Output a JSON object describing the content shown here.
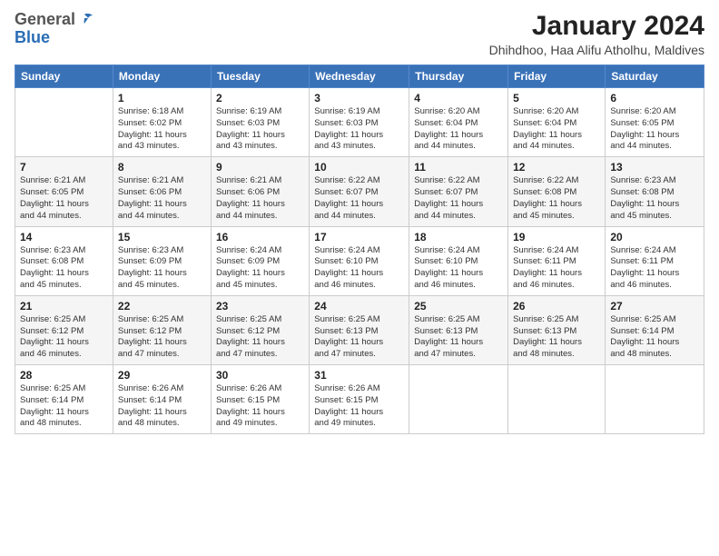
{
  "header": {
    "logo_line1": "General",
    "logo_line2": "Blue",
    "main_title": "January 2024",
    "subtitle": "Dhihdhoo, Haa Alifu Atholhu, Maldives"
  },
  "weekdays": [
    "Sunday",
    "Monday",
    "Tuesday",
    "Wednesday",
    "Thursday",
    "Friday",
    "Saturday"
  ],
  "weeks": [
    [
      {
        "date": "",
        "info": ""
      },
      {
        "date": "1",
        "info": "Sunrise: 6:18 AM\nSunset: 6:02 PM\nDaylight: 11 hours\nand 43 minutes."
      },
      {
        "date": "2",
        "info": "Sunrise: 6:19 AM\nSunset: 6:03 PM\nDaylight: 11 hours\nand 43 minutes."
      },
      {
        "date": "3",
        "info": "Sunrise: 6:19 AM\nSunset: 6:03 PM\nDaylight: 11 hours\nand 43 minutes."
      },
      {
        "date": "4",
        "info": "Sunrise: 6:20 AM\nSunset: 6:04 PM\nDaylight: 11 hours\nand 44 minutes."
      },
      {
        "date": "5",
        "info": "Sunrise: 6:20 AM\nSunset: 6:04 PM\nDaylight: 11 hours\nand 44 minutes."
      },
      {
        "date": "6",
        "info": "Sunrise: 6:20 AM\nSunset: 6:05 PM\nDaylight: 11 hours\nand 44 minutes."
      }
    ],
    [
      {
        "date": "7",
        "info": "Sunrise: 6:21 AM\nSunset: 6:05 PM\nDaylight: 11 hours\nand 44 minutes."
      },
      {
        "date": "8",
        "info": "Sunrise: 6:21 AM\nSunset: 6:06 PM\nDaylight: 11 hours\nand 44 minutes."
      },
      {
        "date": "9",
        "info": "Sunrise: 6:21 AM\nSunset: 6:06 PM\nDaylight: 11 hours\nand 44 minutes."
      },
      {
        "date": "10",
        "info": "Sunrise: 6:22 AM\nSunset: 6:07 PM\nDaylight: 11 hours\nand 44 minutes."
      },
      {
        "date": "11",
        "info": "Sunrise: 6:22 AM\nSunset: 6:07 PM\nDaylight: 11 hours\nand 44 minutes."
      },
      {
        "date": "12",
        "info": "Sunrise: 6:22 AM\nSunset: 6:08 PM\nDaylight: 11 hours\nand 45 minutes."
      },
      {
        "date": "13",
        "info": "Sunrise: 6:23 AM\nSunset: 6:08 PM\nDaylight: 11 hours\nand 45 minutes."
      }
    ],
    [
      {
        "date": "14",
        "info": "Sunrise: 6:23 AM\nSunset: 6:08 PM\nDaylight: 11 hours\nand 45 minutes."
      },
      {
        "date": "15",
        "info": "Sunrise: 6:23 AM\nSunset: 6:09 PM\nDaylight: 11 hours\nand 45 minutes."
      },
      {
        "date": "16",
        "info": "Sunrise: 6:24 AM\nSunset: 6:09 PM\nDaylight: 11 hours\nand 45 minutes."
      },
      {
        "date": "17",
        "info": "Sunrise: 6:24 AM\nSunset: 6:10 PM\nDaylight: 11 hours\nand 46 minutes."
      },
      {
        "date": "18",
        "info": "Sunrise: 6:24 AM\nSunset: 6:10 PM\nDaylight: 11 hours\nand 46 minutes."
      },
      {
        "date": "19",
        "info": "Sunrise: 6:24 AM\nSunset: 6:11 PM\nDaylight: 11 hours\nand 46 minutes."
      },
      {
        "date": "20",
        "info": "Sunrise: 6:24 AM\nSunset: 6:11 PM\nDaylight: 11 hours\nand 46 minutes."
      }
    ],
    [
      {
        "date": "21",
        "info": "Sunrise: 6:25 AM\nSunset: 6:12 PM\nDaylight: 11 hours\nand 46 minutes."
      },
      {
        "date": "22",
        "info": "Sunrise: 6:25 AM\nSunset: 6:12 PM\nDaylight: 11 hours\nand 47 minutes."
      },
      {
        "date": "23",
        "info": "Sunrise: 6:25 AM\nSunset: 6:12 PM\nDaylight: 11 hours\nand 47 minutes."
      },
      {
        "date": "24",
        "info": "Sunrise: 6:25 AM\nSunset: 6:13 PM\nDaylight: 11 hours\nand 47 minutes."
      },
      {
        "date": "25",
        "info": "Sunrise: 6:25 AM\nSunset: 6:13 PM\nDaylight: 11 hours\nand 47 minutes."
      },
      {
        "date": "26",
        "info": "Sunrise: 6:25 AM\nSunset: 6:13 PM\nDaylight: 11 hours\nand 48 minutes."
      },
      {
        "date": "27",
        "info": "Sunrise: 6:25 AM\nSunset: 6:14 PM\nDaylight: 11 hours\nand 48 minutes."
      }
    ],
    [
      {
        "date": "28",
        "info": "Sunrise: 6:25 AM\nSunset: 6:14 PM\nDaylight: 11 hours\nand 48 minutes."
      },
      {
        "date": "29",
        "info": "Sunrise: 6:26 AM\nSunset: 6:14 PM\nDaylight: 11 hours\nand 48 minutes."
      },
      {
        "date": "30",
        "info": "Sunrise: 6:26 AM\nSunset: 6:15 PM\nDaylight: 11 hours\nand 49 minutes."
      },
      {
        "date": "31",
        "info": "Sunrise: 6:26 AM\nSunset: 6:15 PM\nDaylight: 11 hours\nand 49 minutes."
      },
      {
        "date": "",
        "info": ""
      },
      {
        "date": "",
        "info": ""
      },
      {
        "date": "",
        "info": ""
      }
    ]
  ]
}
